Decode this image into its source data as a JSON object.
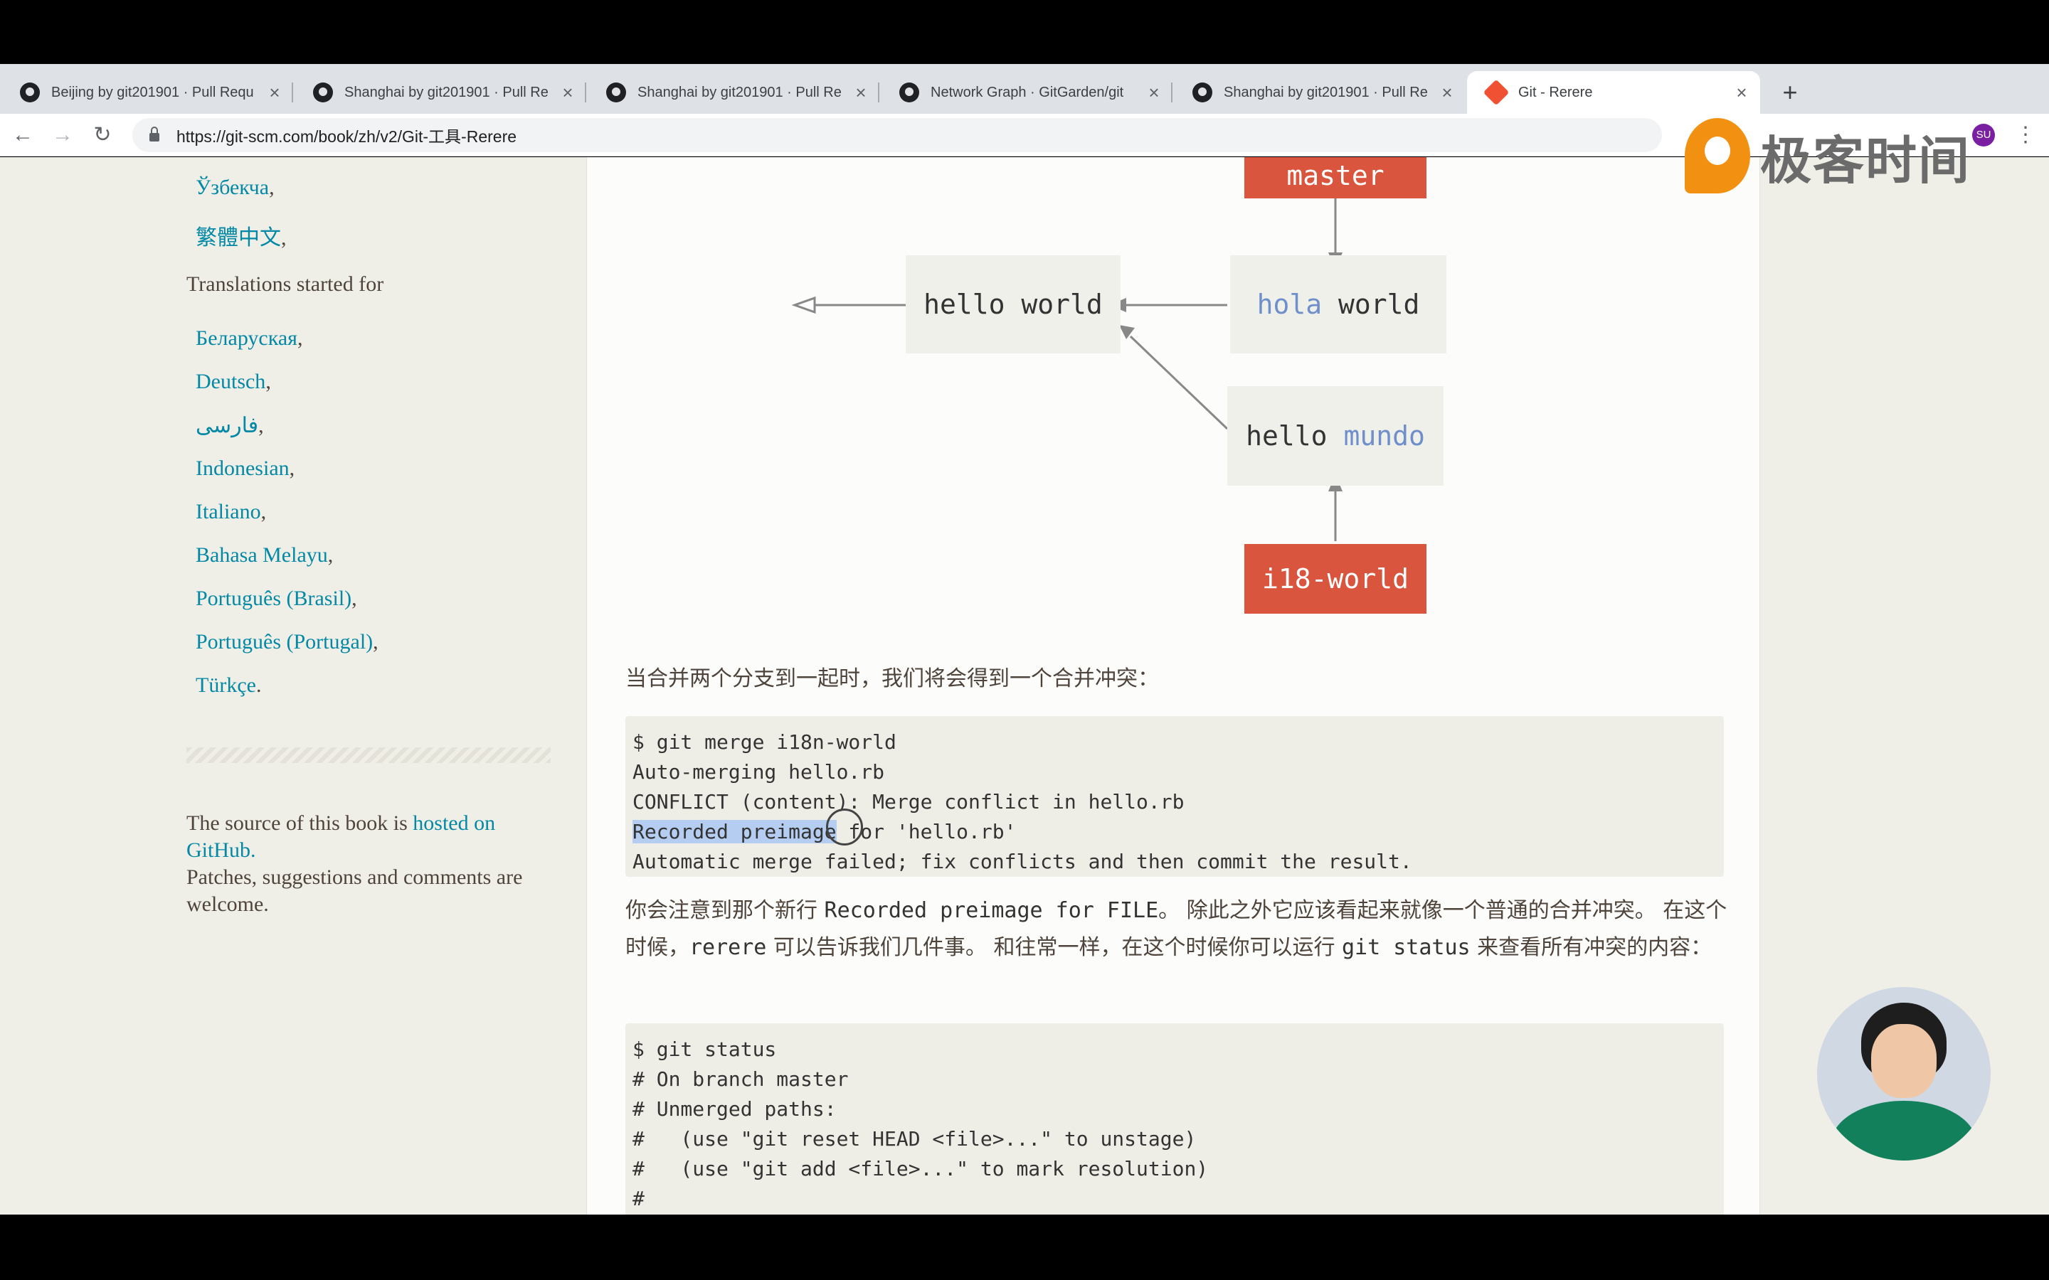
{
  "browser": {
    "tabs": [
      {
        "title": "Beijing by git201901 · Pull Requ",
        "active": false,
        "icon": "github-icon"
      },
      {
        "title": "Shanghai by git201901 · Pull Re",
        "active": false,
        "icon": "github-icon"
      },
      {
        "title": "Shanghai by git201901 · Pull Re",
        "active": false,
        "icon": "github-icon"
      },
      {
        "title": "Network Graph · GitGarden/git",
        "active": false,
        "icon": "github-icon"
      },
      {
        "title": "Shanghai by git201901 · Pull Re",
        "active": false,
        "icon": "github-icon"
      },
      {
        "title": "Git - Rerere",
        "active": true,
        "icon": "git-icon"
      }
    ],
    "new_tab": "+",
    "url": "https://git-scm.com/book/zh/v2/Git-工具-Rerere",
    "profile_initials": "SU"
  },
  "sidebar": {
    "top_languages": [
      "Ўзбекча",
      "繁體中文"
    ],
    "started_heading": "Translations started for",
    "started_languages": [
      "Беларуская",
      "Deutsch",
      "فارسی",
      "Indonesian",
      "Italiano",
      "Bahasa Melayu",
      "Português (Brasil)",
      "Português (Portugal)",
      "Türkçe"
    ],
    "started_last_punct": ".",
    "source_prefix": "The source of this book is ",
    "source_link": "hosted on GitHub.",
    "source_suffix": "Patches, suggestions and comments are welcome."
  },
  "diagram": {
    "master": "master",
    "hello_world": "hello world",
    "hola_word": "hola",
    "hola_rest": " world",
    "hello_mundo_a": "hello ",
    "hello_mundo_b": "mundo",
    "i18_world": "i18-world",
    "colors": {
      "branch_red": "#d9553d",
      "commit_bg": "#f0f0eb",
      "accent_blue": "#6f8fcb"
    }
  },
  "content": {
    "intro": "当合并两个分支到一起时，我们将会得到一个合并冲突：",
    "code1": {
      "l1": "$ git merge i18n-world",
      "l2": "Auto-merging hello.rb",
      "l3": "CONFLICT (content): Merge conflict in hello.rb",
      "l4_selected": "Recorded preimage",
      "l4_rest": " for 'hello.rb'",
      "l5": "Automatic merge failed; fix conflicts and then commit the result."
    },
    "para2": {
      "a": "你会注意到那个新行 ",
      "code_a": "Recorded preimage for FILE",
      "b": "。 除此之外它应该看起来就像一个普通的合并冲突。 在这个时候，",
      "code_b": "rerere",
      "c": " 可以告诉我们几件事。 和往常一样，在这个时候你可以运行 ",
      "code_c": "git status",
      "d": " 来查看所有冲突的内容："
    },
    "code2": {
      "l1": "$ git status",
      "l2": "# On branch master",
      "l3": "# Unmerged paths:",
      "l4": "#   (use \"git reset HEAD <file>...\" to unstage)",
      "l5": "#   (use \"git add <file>...\" to mark resolution)",
      "l6": "#"
    }
  },
  "watermark": {
    "text": "极客时间"
  }
}
